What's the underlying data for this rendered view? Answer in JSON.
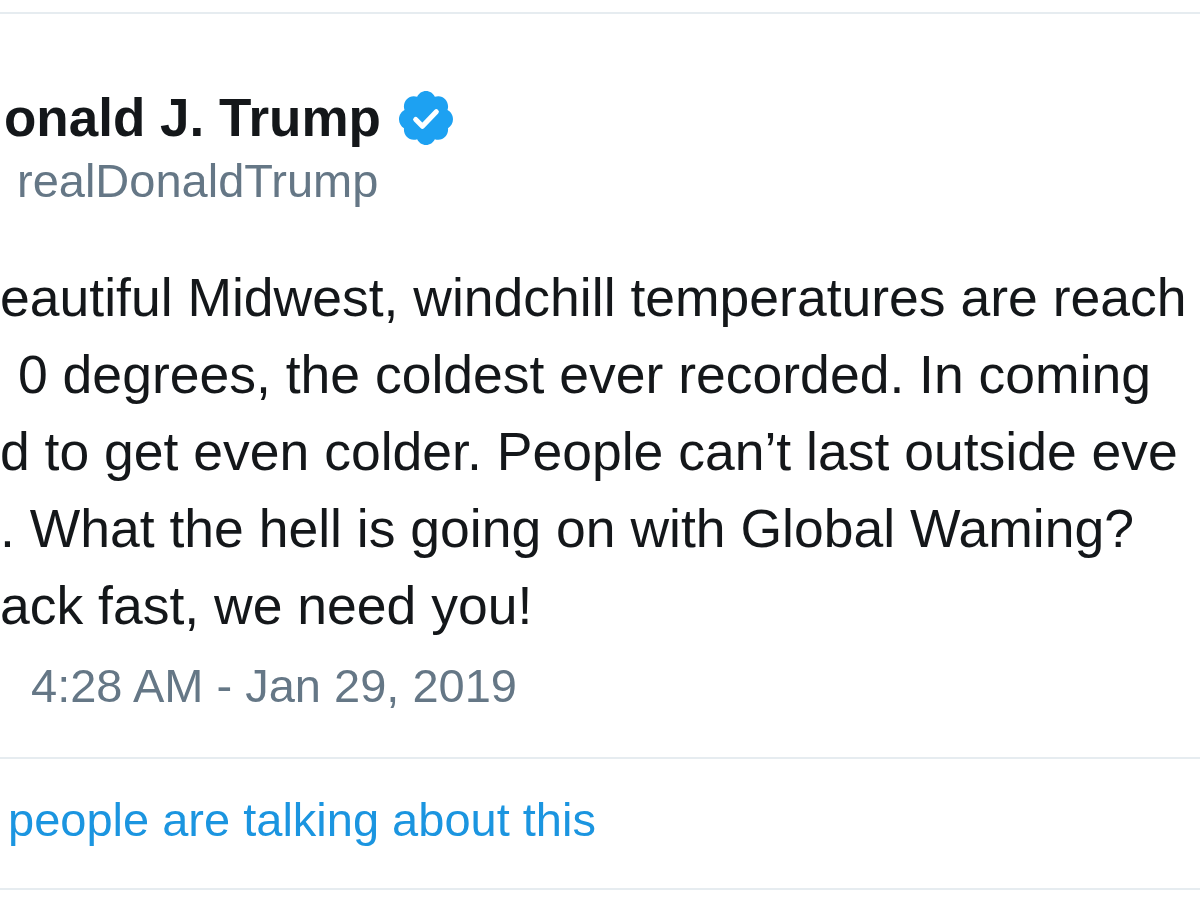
{
  "tweet": {
    "author": {
      "name": "onald J. Trump",
      "verified": true,
      "handle": "realDonaldTrump"
    },
    "text_lines": [
      "eautiful Midwest, windchill temperatures are reach",
      "0 degrees, the coldest ever recorded. In coming",
      "d to get even colder. People can’t last outside eve",
      ". What the hell is going on with Global Waming?",
      "ack fast, we need you!"
    ],
    "timestamp": "4:28 AM - Jan 29, 2019",
    "engagement_link": "people are talking about this"
  }
}
